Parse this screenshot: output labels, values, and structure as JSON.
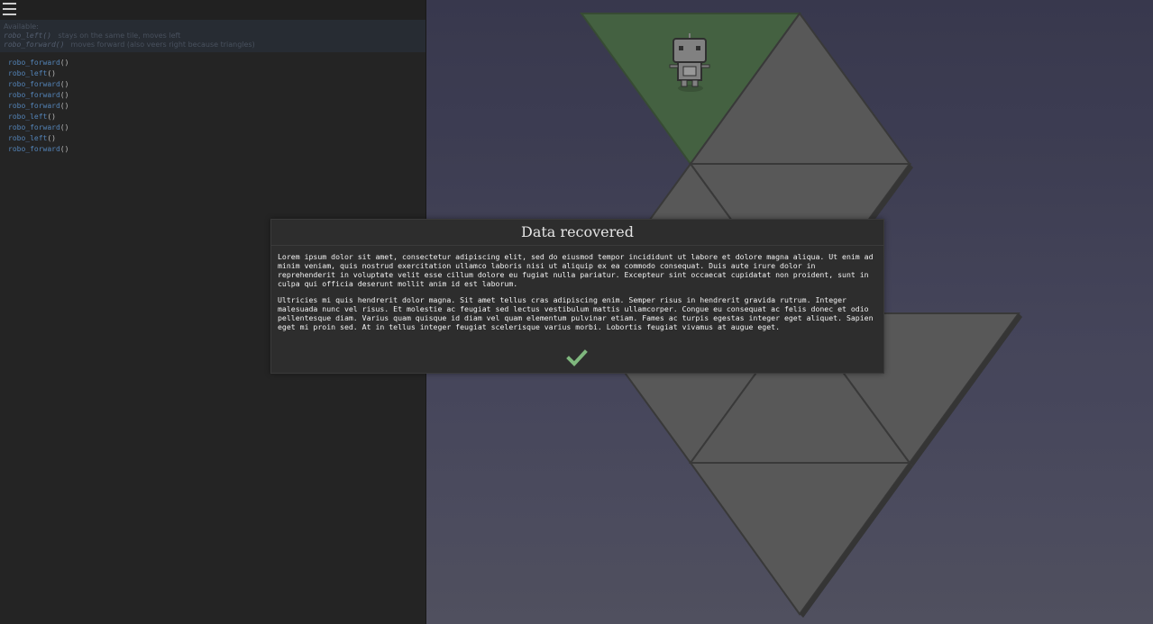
{
  "help": {
    "heading": "Available:",
    "items": [
      {
        "fn": "robo_left()",
        "desc": "stays on the same tile, moves left"
      },
      {
        "fn": "robo_forward()",
        "desc": "moves forward (also veers right because triangles)"
      }
    ]
  },
  "code": [
    {
      "fn": "robo_forward",
      "par": "()"
    },
    {
      "fn": "robo_left",
      "par": "()"
    },
    {
      "fn": "robo_forward",
      "par": "()"
    },
    {
      "fn": "robo_forward",
      "par": "()"
    },
    {
      "fn": "robo_forward",
      "par": "()"
    },
    {
      "fn": "robo_left",
      "par": "()"
    },
    {
      "fn": "robo_forward",
      "par": "()"
    },
    {
      "fn": "robo_left",
      "par": "()"
    },
    {
      "fn": "robo_forward",
      "par": "()"
    }
  ],
  "modal": {
    "title": "Data recovered",
    "paragraphs": [
      "Lorem ipsum dolor sit amet, consectetur adipiscing elit, sed do eiusmod tempor incididunt ut labore et dolore magna aliqua. Ut enim ad minim veniam, quis nostrud exercitation ullamco laboris nisi ut aliquip ex ea commodo consequat. Duis aute irure dolor in reprehenderit in voluptate velit esse cillum dolore eu fugiat nulla pariatur. Excepteur sint occaecat cupidatat non proident, sunt in culpa qui officia deserunt mollit anim id est laborum.",
      "Ultricies mi quis hendrerit dolor magna. Sit amet tellus cras adipiscing enim. Semper risus in hendrerit gravida rutrum. Integer malesuada nunc vel risus. Et molestie ac feugiat sed lectus vestibulum mattis ullamcorper. Congue eu consequat ac felis donec et odio pellentesque diam. Varius quam quisque id diam vel quam elementum pulvinar etiam. Fames ac turpis egestas integer eget aliquet. Sapien eget mi proin sed. At in tellus integer feugiat scelerisque varius morbi. Lobortis feugiat vivamus at augue eget."
    ],
    "confirm_icon": "checkmark-icon"
  },
  "colors": {
    "tile": "#606060",
    "tile_edge": "#3e3e3e",
    "tile_active": "#4a6a47",
    "checkmark": "#7fb77e"
  }
}
